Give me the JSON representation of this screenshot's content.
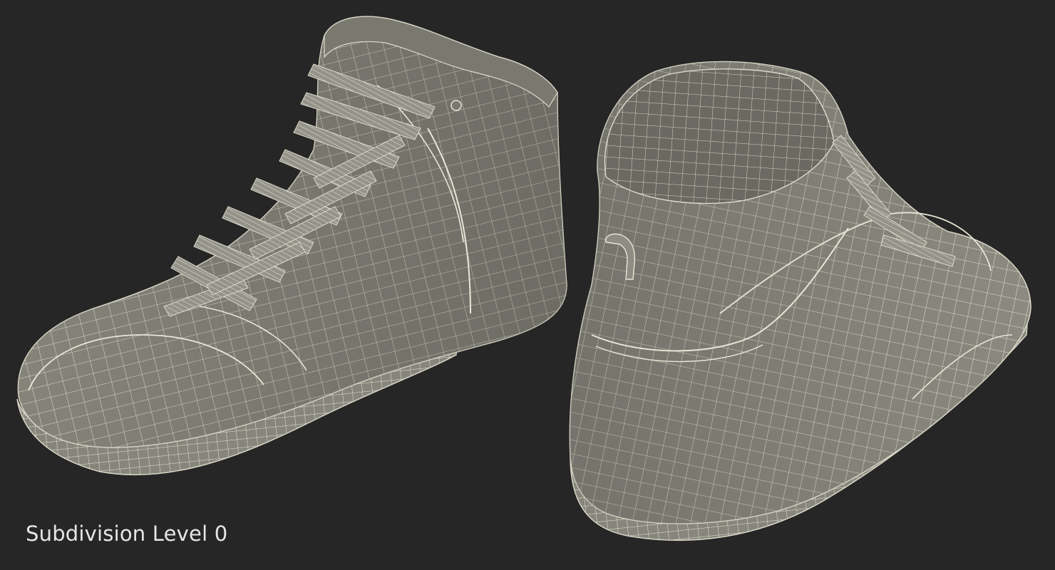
{
  "caption": "Subdivision Level 0",
  "colors": {
    "background": "#262626",
    "model_fill": "#8b8a80",
    "model_shadow": "#6f6e66",
    "wire": "#e4e2d2",
    "caption_text": "#e6e6e6"
  }
}
